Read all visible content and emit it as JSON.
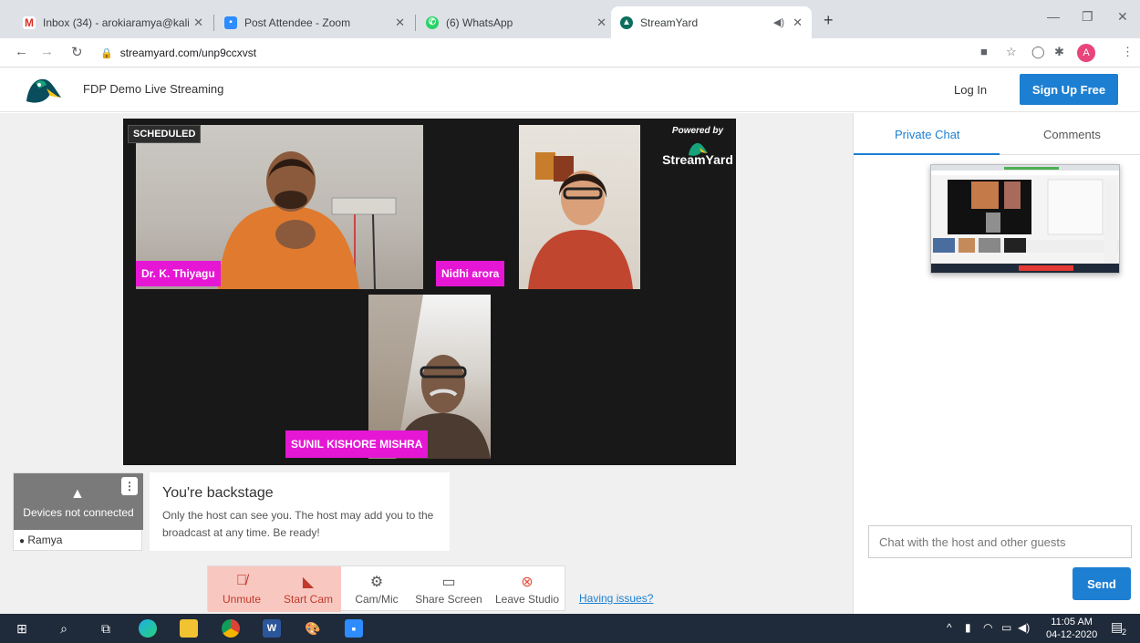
{
  "browser": {
    "tabs": [
      {
        "title": "Inbox (34) - arokiaramya@kalind",
        "icon": "gmail-icon",
        "color": "#d93025"
      },
      {
        "title": "Post Attendee - Zoom",
        "icon": "zoom-icon",
        "color": "#2d8cff"
      },
      {
        "title": "(6) WhatsApp",
        "icon": "whatsapp-icon",
        "color": "#25d366"
      },
      {
        "title": "StreamYard",
        "icon": "streamyard-icon",
        "color": "#0a6e5c"
      }
    ],
    "new_tab": "+",
    "url": "streamyard.com/unp9ccxvst",
    "profile_initial": "A"
  },
  "site": {
    "title": "FDP Demo Live Streaming",
    "login": "Log In",
    "signup": "Sign Up Free"
  },
  "stage": {
    "status": "SCHEDULED",
    "powered_by": "Powered by",
    "brand": "StreamYard",
    "participants": [
      {
        "name": "Dr. K. Thiyagu"
      },
      {
        "name": "Nidhi arora"
      },
      {
        "name": "SUNIL KISHORE MISHRA"
      }
    ]
  },
  "device": {
    "status": "Devices not connected",
    "user": "Ramya"
  },
  "backstage": {
    "heading": "You're backstage",
    "message": "Only the host can see you. The host may add you to the broadcast at any time. Be ready!"
  },
  "controls": {
    "unmute": "Unmute",
    "start_cam": "Start Cam",
    "cam_mic": "Cam/Mic",
    "share_screen": "Share Screen",
    "leave": "Leave Studio",
    "issues": "Having issues?"
  },
  "chat": {
    "tab_private": "Private Chat",
    "tab_comments": "Comments",
    "placeholder": "Chat with the host and other guests",
    "send": "Send"
  },
  "taskbar": {
    "time": "11:05 AM",
    "date": "04-12-2020",
    "notifications": "2"
  },
  "colors": {
    "accent": "#1d7fd1",
    "name_tag": "#e517d4"
  }
}
